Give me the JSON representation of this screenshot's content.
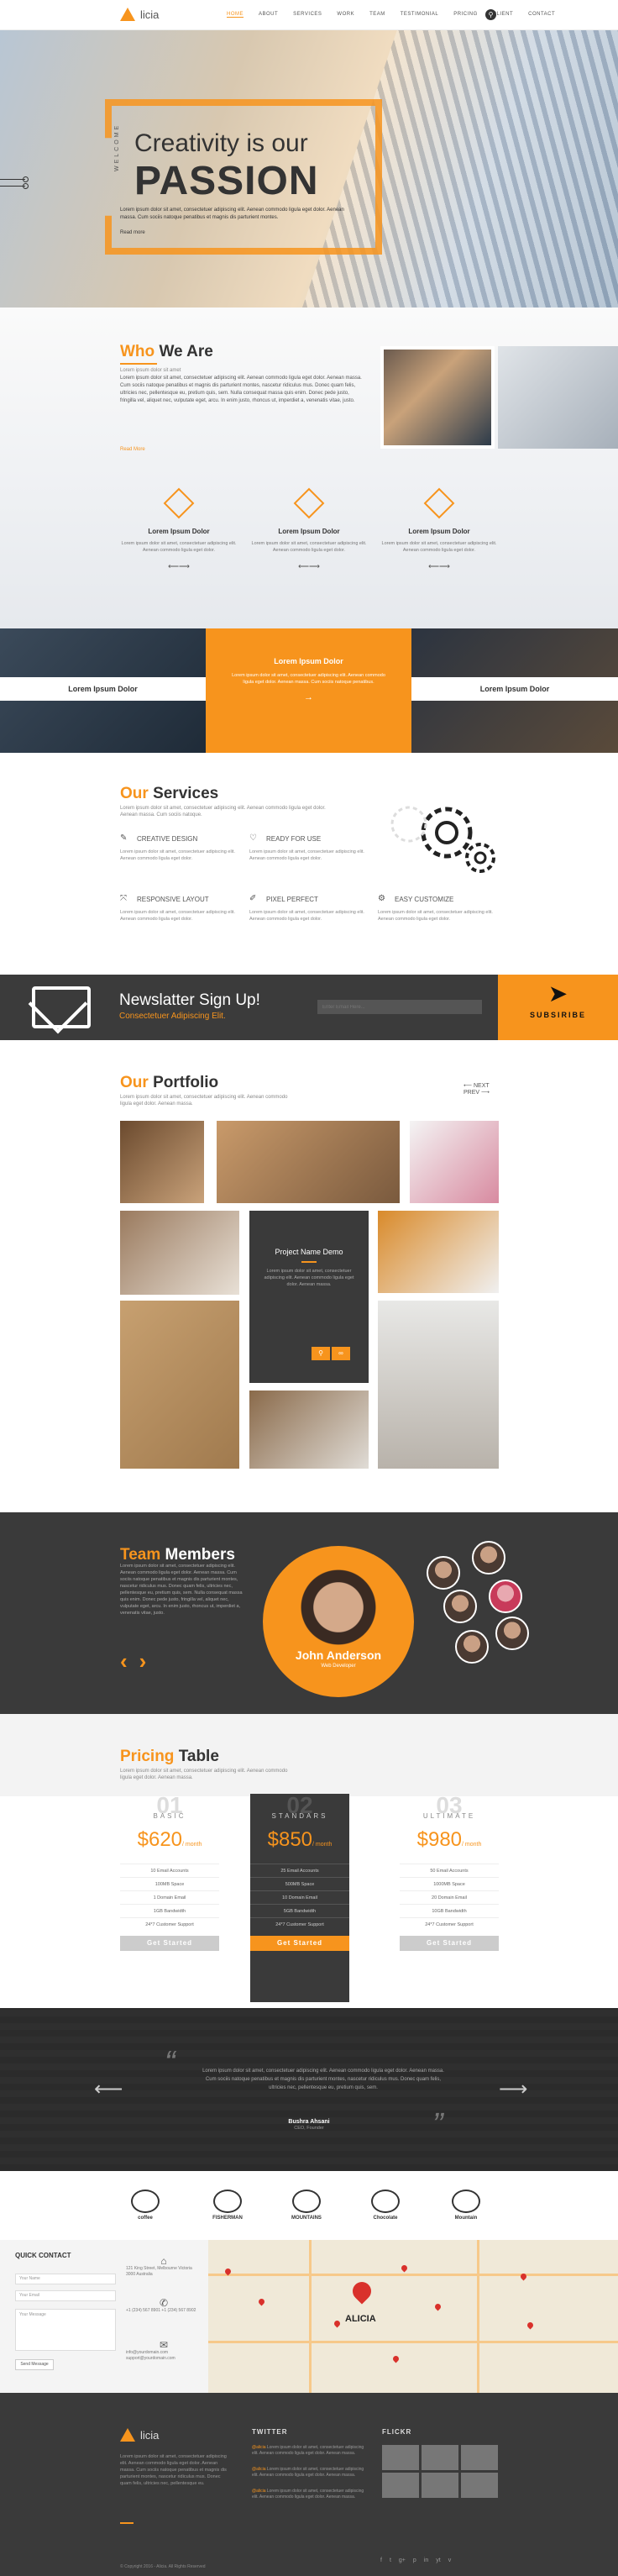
{
  "nav": {
    "logo": "licia",
    "items": [
      "HOME",
      "ABOUT",
      "SERVICES",
      "WORK",
      "TEAM",
      "TESTIMONIAL",
      "PRICING",
      "CLIENT",
      "CONTACT"
    ]
  },
  "hero": {
    "welcome": "WELCOME",
    "line1": "Creativity is our",
    "line2": "PASSION",
    "body": "Lorem ipsum dolor sit amet, consectetuer adipiscing elit. Aenean commodo ligula eget dolor. Aenean massa. Cum sociis natoque penatibus et magnis dis parturient montes.",
    "link": "Read more"
  },
  "about": {
    "title_a": "Who",
    "title_b": "We Are",
    "sub": "Lorem ipsum dolor sit amet",
    "body": "Lorem ipsum dolor sit amet, consectetuer adipiscing elit. Aenean commodo ligula eget dolor. Aenean massa. Cum sociis natoque penatibus et magnis dis parturient montes, nascetur ridiculus mus. Donec quam felis, ultricies nec, pellentesque eu, pretium quis, sem. Nulla consequat massa quis enim. Donec pede justo, fringilla vel, aliquet nec, vulputate eget, arcu. In enim justo, rhoncus ut, imperdiet a, venenatis vitae, justo.",
    "link": "Read More",
    "features": [
      {
        "title": "Lorem Ipsum Dolor",
        "text": "Lorem ipsum dolor sit amet, consectetuer adipiscing elit. Aenean commodo ligula eget dolor."
      },
      {
        "title": "Lorem Ipsum Dolor",
        "text": "Lorem ipsum dolor sit amet, consectetuer adipiscing elit. Aenean commodo ligula eget dolor."
      },
      {
        "title": "Lorem Ipsum Dolor",
        "text": "Lorem ipsum dolor sit amet, consectetuer adipiscing elit. Aenean commodo ligula eget dolor."
      }
    ]
  },
  "strip": {
    "left": "Lorem Ipsum Dolor",
    "mid_title": "Lorem Ipsum Dolor",
    "mid_text": "Lorem ipsum dolor sit amet, consectetuer adipiscing elit. Aenean commodo ligula eget dolor. Aenean massa. Cum sociis natoque penatibus.",
    "right": "Lorem Ipsum Dolor"
  },
  "services": {
    "title_a": "Our",
    "title_b": "Services",
    "sub": "Lorem ipsum dolor sit amet, consectetuer adipiscing elit. Aenean commodo ligula eget dolor. Aenean massa. Cum sociis natoque.",
    "items": [
      {
        "icon": "pencil-icon",
        "label": "CREATIVE DESIGN",
        "text": "Lorem ipsum dolor sit amet, consectetuer adipiscing elit. Aenean commodo ligula eget dolor."
      },
      {
        "icon": "heart-icon",
        "label": "READY FOR USE",
        "text": "Lorem ipsum dolor sit amet, consectetuer adipiscing elit. Aenean commodo ligula eget dolor."
      },
      {
        "icon": "arrows-icon",
        "label": "RESPONSIVE LAYOUT",
        "text": "Lorem ipsum dolor sit amet, consectetuer adipiscing elit. Aenean commodo ligula eget dolor."
      },
      {
        "icon": "brush-icon",
        "label": "PIXEL PERFECT",
        "text": "Lorem ipsum dolor sit amet, consectetuer adipiscing elit. Aenean commodo ligula eget dolor."
      },
      {
        "icon": "gear-icon",
        "label": "EASY CUSTOMIZE",
        "text": "Lorem ipsum dolor sit amet, consectetuer adipiscing elit. Aenean commodo ligula eget dolor."
      }
    ]
  },
  "newsletter": {
    "title": "Newslatter Sign Up!",
    "sub": "Consectetuer Adipiscing Elit.",
    "placeholder": "Enter Email Here...",
    "button": "SUBSIRIBE"
  },
  "portfolio": {
    "title_a": "Our",
    "title_b": "Portfolio",
    "sub": "Lorem ipsum dolor sit amet, consectetuer adipiscing elit. Aenean commodo ligula eget dolor. Aenean massa.",
    "nav_next": "NEXT",
    "nav_prev": "PREV",
    "project_title": "Project Name Demo",
    "project_text": "Lorem ipsum dolor sit amet, consectetuer adipiscing elit. Aenean commodo ligula eget dolor. Aenean massa."
  },
  "team": {
    "title_a": "Team",
    "title_b": "Members",
    "body": "Lorem ipsum dolor sit amet, consectetuer adipiscing elit. Aenean commodo ligula eget dolor. Aenean massa. Cum sociis natoque penatibus et magnis dis parturient montes, nascetur ridiculus mus. Donec quam felis, ultricies nec, pellentesque eu, pretium quis, sem. Nulla consequat massa quis enim. Donec pede justo, fringilla vel, aliquet nec, vulputate eget, arcu. In enim justo, rhoncus ut, imperdiet a, venenatis vitae, justo.",
    "name": "John Anderson",
    "role": "Web Developer"
  },
  "pricing": {
    "title_a": "Pricing",
    "title_b": "Table",
    "sub": "Lorem ipsum dolor sit amet, consectetuer adipiscing elit. Aenean commodo ligula eget dolor. Aenean massa.",
    "plans": [
      {
        "num": "01",
        "name": "BASIC",
        "currency": "$",
        "price": "620",
        "period": "/ month",
        "features": [
          "10 Email Accounts",
          "100MB Space",
          "1 Domain Email",
          "1GB Bandwidth",
          "24*7 Customer Support"
        ],
        "button": "Get Started"
      },
      {
        "num": "02",
        "name": "STANDARS",
        "currency": "$",
        "price": "850",
        "period": "/ month",
        "features": [
          "25 Email Accounts",
          "500MB Space",
          "10 Domain Email",
          "5GB Bandwidth",
          "24*7 Customer Support"
        ],
        "button": "Get Started"
      },
      {
        "num": "03",
        "name": "ULTIMATE",
        "currency": "$",
        "price": "980",
        "period": "/ month",
        "features": [
          "50 Email Accounts",
          "1000MB Space",
          "20 Domain Email",
          "10GB Bandwidth",
          "24*7 Customer Support"
        ],
        "button": "Get Started"
      }
    ]
  },
  "testimonial": {
    "text": "Lorem ipsum dolor sit amet, consectetuer adipiscing elit. Aenean commodo ligula eget dolor. Aenean massa. Cum sociis natoque penatibus et magnis dis parturient montes, nascetur ridiculus mus. Donec quam felis, ultricies nec, pellentesque eu, pretium quis, sem.",
    "author": "Bushra Ahsani",
    "role": "CEO, Founder"
  },
  "clients": [
    "coffee",
    "FISHERMAN",
    "MOUNTAINS",
    "Chocolate",
    "Mountain"
  ],
  "contact": {
    "title": "QUICK CONTACT",
    "name_ph": "Your Name",
    "email_ph": "Your Email",
    "msg_ph": "Your Message",
    "send": "Send Message",
    "address": "121 King Street, Melbourne Victoria 3000 Australia",
    "phone": "+1 (234) 567 8901 +1 (234) 567 8902",
    "email": "info@yourdomain.com support@yourdomain.com",
    "map_city": "ALICIA"
  },
  "footer": {
    "logo": "licia",
    "about": "Lorem ipsum dolor sit amet, consectetuer adipiscing elit. Aenean commodo ligula eget dolor. Aenean massa. Cum sociis natoque penatibus et magnis dis parturient montes, nascetur ridiculus mus. Donec quam felis, ultricies nec, pellentesque eu.",
    "twitter_title": "TWITTER",
    "tweets": [
      {
        "handle": "@alicia",
        "text": "Lorem ipsum dolor sit amet, consectetuer adipiscing elit. Aenean commodo ligula eget dolor. Aenean massa."
      },
      {
        "handle": "@alicia",
        "text": "Lorem ipsum dolor sit amet, consectetuer adipiscing elit. Aenean commodo ligula eget dolor. Aenean massa."
      },
      {
        "handle": "@alicia",
        "text": "Lorem ipsum dolor sit amet, consectetuer adipiscing elit. Aenean commodo ligula eget dolor. Aenean massa."
      }
    ],
    "flickr_title": "FLICKR",
    "social": [
      "f",
      "t",
      "g+",
      "p",
      "in",
      "yt",
      "v"
    ],
    "copyright": "© Copyright 2016 - Alicia. All Rights Reserved"
  }
}
